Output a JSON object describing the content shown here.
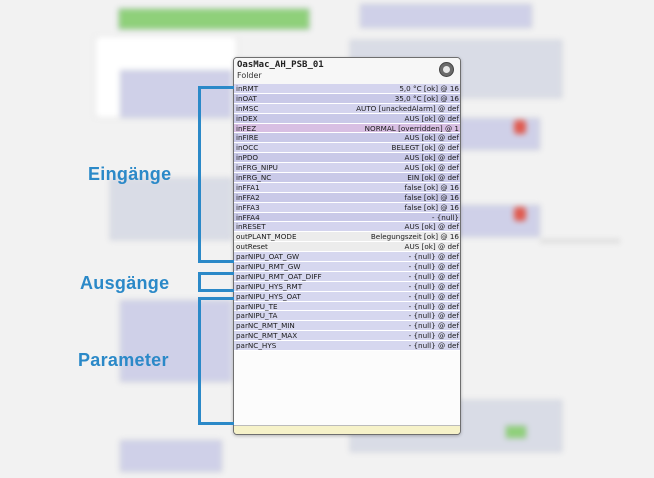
{
  "block": {
    "title": "OasMac_AH_PSB_01",
    "subtitle": "Folder",
    "icon": "gear-icon",
    "rows": [
      {
        "name": "inRMT",
        "value": "5,0 °C [ok] @ 16",
        "kind": "input"
      },
      {
        "name": "inOAT",
        "value": "35,0 °C [ok] @ 16",
        "kind": "input"
      },
      {
        "name": "inMSC",
        "value": "AUTO [unackedAlarm] @ def",
        "kind": "input"
      },
      {
        "name": "inDEX",
        "value": "AUS [ok] @ def",
        "kind": "input"
      },
      {
        "name": "inFEZ",
        "value": "NORMAL [overridden] @ 1",
        "kind": "overridden"
      },
      {
        "name": "inFIRE",
        "value": "AUS [ok] @ def",
        "kind": "input"
      },
      {
        "name": "inOCC",
        "value": "BELEGT [ok] @ def",
        "kind": "input"
      },
      {
        "name": "inPDO",
        "value": "AUS [ok] @ def",
        "kind": "input"
      },
      {
        "name": "inFRG_NIPU",
        "value": "AUS [ok] @ def",
        "kind": "input"
      },
      {
        "name": "inFRG_NC",
        "value": "EIN [ok] @ def",
        "kind": "input"
      },
      {
        "name": "inFFA1",
        "value": "false [ok] @ 16",
        "kind": "input"
      },
      {
        "name": "inFFA2",
        "value": "false [ok] @ 16",
        "kind": "input"
      },
      {
        "name": "inFFA3",
        "value": "false [ok] @ 16",
        "kind": "input"
      },
      {
        "name": "inFFA4",
        "value": "- {null}",
        "kind": "input"
      },
      {
        "name": "inRESET",
        "value": "AUS [ok] @ def",
        "kind": "input"
      },
      {
        "name": "outPLANT_MODE",
        "value": "Belegungszeit [ok] @ 16",
        "kind": "output"
      },
      {
        "name": "outReset",
        "value": "AUS [ok] @ def",
        "kind": "output"
      },
      {
        "name": "parNIPU_OAT_GW",
        "value": "- {null} @ def",
        "kind": "param"
      },
      {
        "name": "parNIPU_RMT_GW",
        "value": "- {null} @ def",
        "kind": "param"
      },
      {
        "name": "parNIPU_RMT_OAT_DIFF",
        "value": "- {null} @ def",
        "kind": "param"
      },
      {
        "name": "parNIPU_HYS_RMT",
        "value": "- {null} @ def",
        "kind": "param"
      },
      {
        "name": "parNIPU_HYS_OAT",
        "value": "- {null} @ def",
        "kind": "param"
      },
      {
        "name": "parNIPU_TE",
        "value": "- {null} @ def",
        "kind": "param"
      },
      {
        "name": "parNIPU_TA",
        "value": "- {null} @ def",
        "kind": "param"
      },
      {
        "name": "parNC_RMT_MIN",
        "value": "- {null} @ def",
        "kind": "param"
      },
      {
        "name": "parNC_RMT_MAX",
        "value": "- {null} @ def",
        "kind": "param"
      },
      {
        "name": "parNC_HYS",
        "value": "- {null} @ def",
        "kind": "param"
      }
    ]
  },
  "annotations": {
    "inputs_label": "Eingänge",
    "outputs_label": "Ausgänge",
    "params_label": "Parameter",
    "accent_color": "#2b89c8"
  }
}
